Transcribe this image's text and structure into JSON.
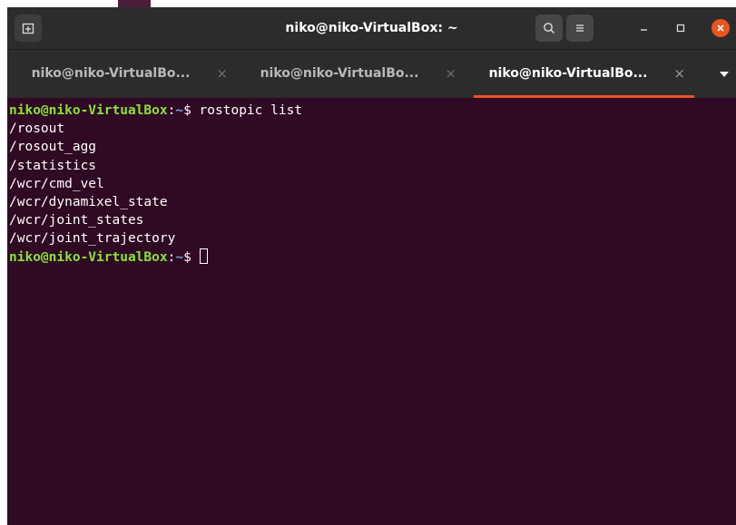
{
  "window": {
    "title": "niko@niko-VirtualBox: ~"
  },
  "tabs": [
    {
      "label": "niko@niko-VirtualBo...",
      "close": "×",
      "active": false
    },
    {
      "label": "niko@niko-VirtualBo...",
      "close": "×",
      "active": false
    },
    {
      "label": "niko@niko-VirtualBo...",
      "close": "×",
      "active": true
    }
  ],
  "terminal": {
    "prompt_user": "niko@niko-VirtualBox",
    "prompt_sep": ":",
    "prompt_path": "~",
    "prompt_symbol": "$",
    "command": "rostopic list",
    "output": [
      "/rosout",
      "/rosout_agg",
      "/statistics",
      "/wcr/cmd_vel",
      "/wcr/dynamixel_state",
      "/wcr/joint_states",
      "/wcr/joint_trajectory"
    ]
  },
  "colors": {
    "terminal_bg": "#300a24",
    "prompt_user": "#8ae234",
    "prompt_path": "#729fcf",
    "accent": "#e95420",
    "headerbar": "#2c2c2c"
  },
  "icons": {
    "new_tab": "new-tab-icon",
    "search": "search-icon",
    "menu": "hamburger-menu-icon",
    "minimize": "minimize-icon",
    "maximize": "maximize-icon",
    "close": "close-icon",
    "tab_list": "chevron-down-icon"
  }
}
